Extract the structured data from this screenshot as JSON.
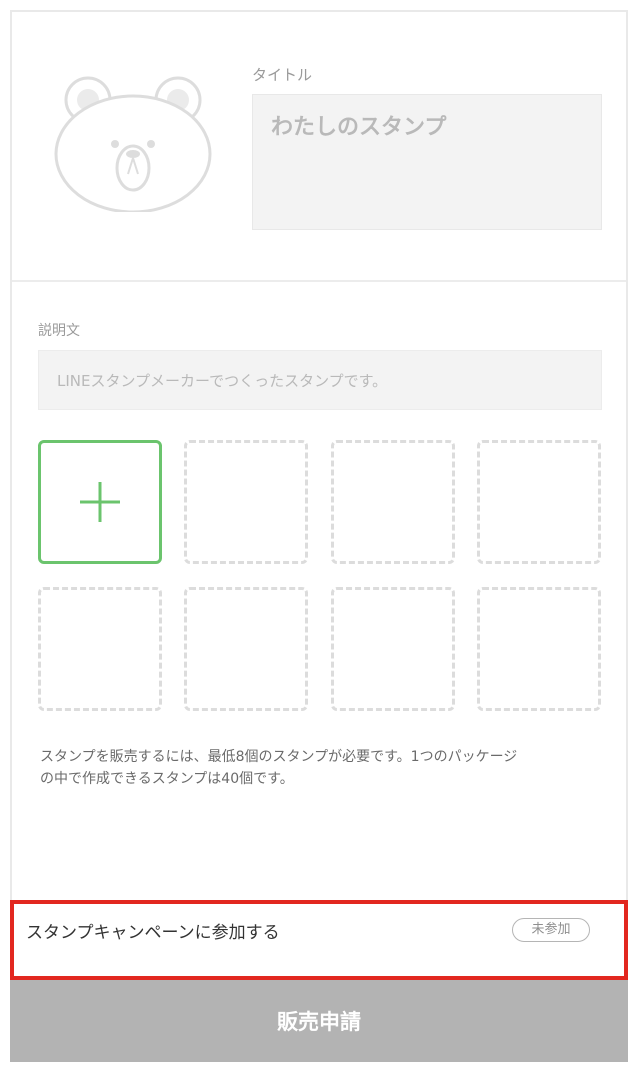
{
  "header": {
    "title_label": "タイトル",
    "title_placeholder": "わたしのスタンプ",
    "avatar_icon": "bear-face-icon"
  },
  "description": {
    "label": "説明文",
    "placeholder": "LINEスタンプメーカーでつくったスタンプです。"
  },
  "stickers": {
    "add_icon": "plus-icon",
    "slot_count": 8
  },
  "note": {
    "line1": "スタンプを販売するには、最低8個のスタンプが必要です。1つのパッケージ",
    "line2": "の中で作成できるスタンプは40個です。"
  },
  "campaign": {
    "label": "スタンプキャンペーンに参加する",
    "status": "未参加"
  },
  "submit": {
    "label": "販売申請"
  },
  "colors": {
    "accent_green": "#6bc46d",
    "highlight_red": "#e2271f",
    "submit_gray": "#b3b3b3"
  }
}
